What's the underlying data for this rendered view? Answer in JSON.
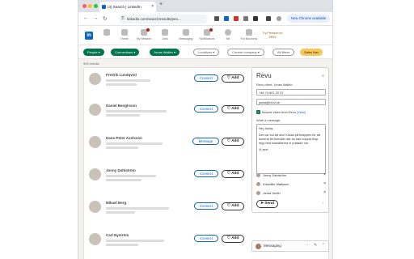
{
  "browser": {
    "tab_title": "(4) Search | LinkedIn",
    "tab_close": "×",
    "new_tab": "+",
    "url": "linkedin.com/search/results/peo...",
    "lock": "⚿",
    "back": "←",
    "forward": "→",
    "reload": "↻",
    "chrome_button": "New Chrome available"
  },
  "nav": {
    "logo": "in",
    "items": [
      "Home",
      "My Network",
      "Jobs",
      "Messaging",
      "Notifications",
      "Me",
      "For Business"
    ],
    "premium": "Try Premium for SEK0"
  },
  "filters": [
    {
      "label": "People ▾",
      "style": "on"
    },
    {
      "label": "Connections ▾",
      "style": "on"
    },
    {
      "label": "Jonas Wallén ▾",
      "style": "on"
    },
    {
      "label": "Locations ▾",
      "style": "off"
    },
    {
      "label": "Current company ▾",
      "style": "off"
    },
    {
      "label": "All filters",
      "style": "off"
    },
    {
      "label": "Sales Nav",
      "style": "gold"
    }
  ],
  "results_label": "909 results",
  "people": [
    {
      "name": "Fredrik Lundqvist",
      "action": "Connect",
      "add": "♡ Add"
    },
    {
      "name": "Daniel Bengtsson",
      "action": "Connect",
      "add": "♡ Add"
    },
    {
      "name": "Hans-Peter Axelsson",
      "action": "Message",
      "add": "♡ Add"
    },
    {
      "name": "Jonny Dahlström",
      "action": "Connect",
      "add": "♡ Add"
    },
    {
      "name": "Mikael Berg",
      "action": "Connect",
      "add": "♡ Add"
    },
    {
      "name": "Carl Nyström",
      "action": "Connect",
      "add": "♡ Add"
    }
  ],
  "revu": {
    "logo": "Revu",
    "menu": "≡",
    "client_label": "Revu client: Jonas Wallén",
    "phone": "+46 70 607 20 37",
    "email": "jonas@revu.se",
    "include_label": "Include video from Revu",
    "view_link": "[View]",
    "message_label": "Write a message:",
    "message_lines": [
      "Hej Jonas,",
      "Det var kul att ses! Klicka på knappen för att komma till formulär där du kan koppla ihop mig med kontakterna vi pratade om.",
      "Vi ses!"
    ],
    "recipients": [
      "Jonny Dahlström",
      "Kristoffer Mattsson",
      "Jonas Hedin"
    ],
    "remove": "×",
    "send": "➤ Send",
    "send_chevron": "›"
  },
  "messaging": {
    "title": "Messaging",
    "icons": [
      "⋯",
      "✎",
      "⌃"
    ]
  }
}
